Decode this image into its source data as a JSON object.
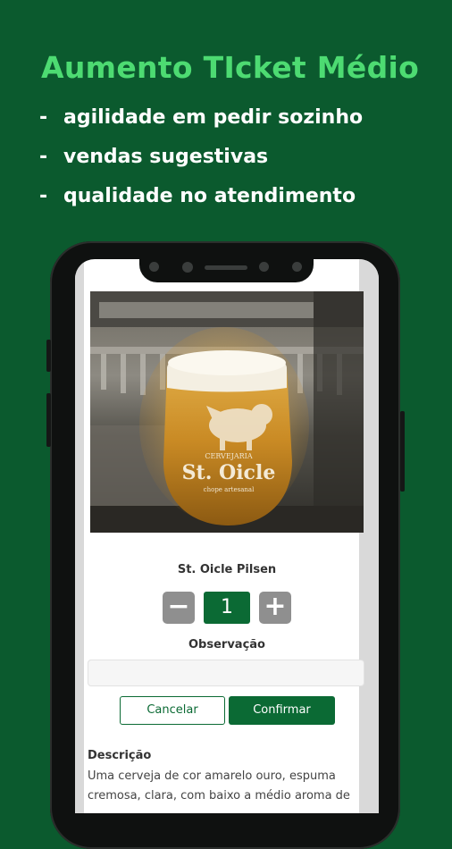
{
  "headline": "Aumento TIcket Médio",
  "bullets": [
    {
      "dash": "-",
      "text": "agilidade em pedir sozinho"
    },
    {
      "dash": "-",
      "text": "vendas sugestivas"
    },
    {
      "dash": "-",
      "text": "qualidade no atendimento"
    }
  ],
  "product": {
    "image_glass_brand_line1": "CERVEJARIA",
    "image_glass_brand_line2": "St. Oicle",
    "image_glass_brand_line3": "chope artesanal",
    "name": "St. Oicle Pilsen",
    "quantity": "1",
    "minus_symbol": "−",
    "plus_symbol": "+"
  },
  "observation": {
    "label": "Observação",
    "value": "",
    "placeholder": ""
  },
  "actions": {
    "cancel": "Cancelar",
    "confirm": "Confirmar"
  },
  "description": {
    "title": "Descrição",
    "text": "Uma cerveja de cor amarelo ouro, espuma cremosa, clara, com baixo a médio aroma de"
  },
  "colors": {
    "background": "#0b5a2e",
    "headline": "#4ddb72",
    "accent": "#0b6a34",
    "stepper_button": "#8f8f8f"
  },
  "icons": [
    "minus-icon",
    "plus-icon",
    "front-camera-icon",
    "speaker-grille-icon"
  ]
}
